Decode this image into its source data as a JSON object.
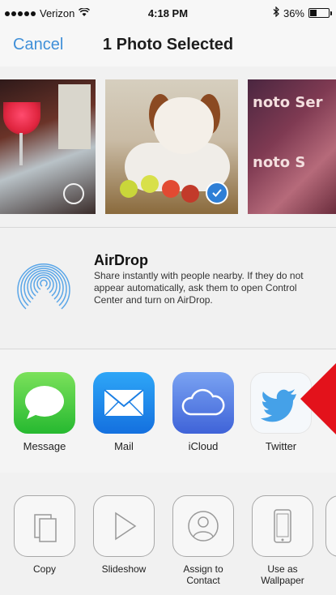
{
  "status_bar": {
    "carrier": "Verizon",
    "time": "4:18 PM",
    "battery": "36%",
    "battery_level": 0.36,
    "signal_icon": "signal-dots-icon",
    "wifi_icon": "wifi-icon",
    "bluetooth_icon": "bluetooth-icon",
    "battery_icon": "battery-icon"
  },
  "nav": {
    "cancel_label": "Cancel",
    "title": "1 Photo Selected"
  },
  "photos": [
    {
      "selected": false
    },
    {
      "selected": true
    },
    {
      "selected": false,
      "overlay_text": [
        "noto Ser",
        "noto S"
      ]
    }
  ],
  "airdrop": {
    "title": "AirDrop",
    "description": "Share instantly with people nearby. If they do not appear automatically, ask them to open Control Center and turn on AirDrop.",
    "icon": "airdrop-icon"
  },
  "share_apps": [
    {
      "label": "Message",
      "icon": "message-icon"
    },
    {
      "label": "Mail",
      "icon": "mail-icon"
    },
    {
      "label": "iCloud",
      "icon": "icloud-icon"
    },
    {
      "label": "Twitter",
      "icon": "twitter-icon"
    }
  ],
  "actions": [
    {
      "label": "Copy",
      "icon": "copy-icon"
    },
    {
      "label": "Slideshow",
      "icon": "slideshow-icon"
    },
    {
      "label": "Assign to Contact",
      "icon": "contact-icon"
    },
    {
      "label": "Use as Wallpaper",
      "icon": "wallpaper-icon"
    }
  ],
  "colors": {
    "accent": "#3f8fd8",
    "arrow": "#e3121b"
  }
}
